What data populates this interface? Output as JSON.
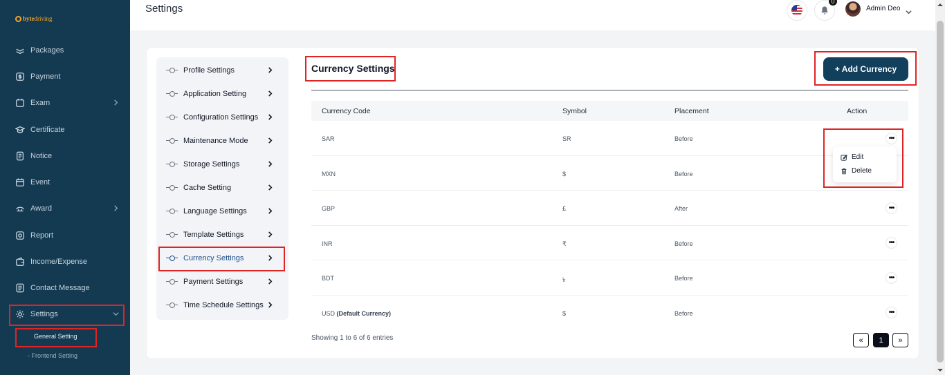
{
  "brand": {
    "logo_prefix": "byte",
    "logo_suffix": "driving"
  },
  "sidebar": {
    "items": [
      {
        "label": "Packages",
        "icon": "layers-icon"
      },
      {
        "label": "Payment",
        "icon": "dollar-icon"
      },
      {
        "label": "Exam",
        "icon": "exam-icon",
        "has_children": true
      },
      {
        "label": "Certificate",
        "icon": "certificate-icon"
      },
      {
        "label": "Notice",
        "icon": "notice-icon"
      },
      {
        "label": "Event",
        "icon": "calendar-icon"
      },
      {
        "label": "Award",
        "icon": "award-icon",
        "has_children": true
      },
      {
        "label": "Report",
        "icon": "report-icon"
      },
      {
        "label": "Income/Expense",
        "icon": "wallet-icon"
      },
      {
        "label": "Contact Message",
        "icon": "message-icon"
      },
      {
        "label": "Settings",
        "icon": "gear-icon",
        "expanded": true
      }
    ],
    "sub_items": [
      {
        "label": "General Setting",
        "active": true
      },
      {
        "label": "Frontend Setting",
        "active": false
      }
    ]
  },
  "header": {
    "title": "Settings",
    "notification_count": "0",
    "user_name": "Admin Deo"
  },
  "settings_menu": {
    "items": [
      "Profile Settings",
      "Application Setting",
      "Configuration Settings",
      "Maintenance Mode",
      "Storage Settings",
      "Cache Setting",
      "Language Settings",
      "Template Settings",
      "Currency Settings",
      "Payment Settings",
      "Time Schedule Settings"
    ],
    "active": "Currency Settings"
  },
  "currency": {
    "title": "Currency Settings",
    "add_button": "+ Add Currency",
    "columns": [
      "Currency Code",
      "Symbol",
      "Placement",
      "Action"
    ],
    "rows": [
      {
        "code": "SAR",
        "tag": "",
        "symbol": "SR",
        "placement": "Before"
      },
      {
        "code": "MXN",
        "tag": "",
        "symbol": "$",
        "placement": "Before"
      },
      {
        "code": "GBP",
        "tag": "",
        "symbol": "£",
        "placement": "After"
      },
      {
        "code": "INR",
        "tag": "",
        "symbol": "₹",
        "placement": "Before"
      },
      {
        "code": "BDT",
        "tag": "",
        "symbol": "৳",
        "placement": "Before"
      },
      {
        "code": "USD",
        "tag": "(Default Currency)",
        "symbol": "$",
        "placement": "Before"
      }
    ],
    "action_menu": {
      "edit": "Edit",
      "delete": "Delete"
    },
    "entries_text": "Showing 1 to 6 of 6 entries",
    "pagination": {
      "prev": "«",
      "current": "1",
      "next": "»"
    }
  },
  "colors": {
    "sidebar_bg": "#143a52",
    "accent": "#123f5c",
    "highlight_box": "#e02424"
  }
}
